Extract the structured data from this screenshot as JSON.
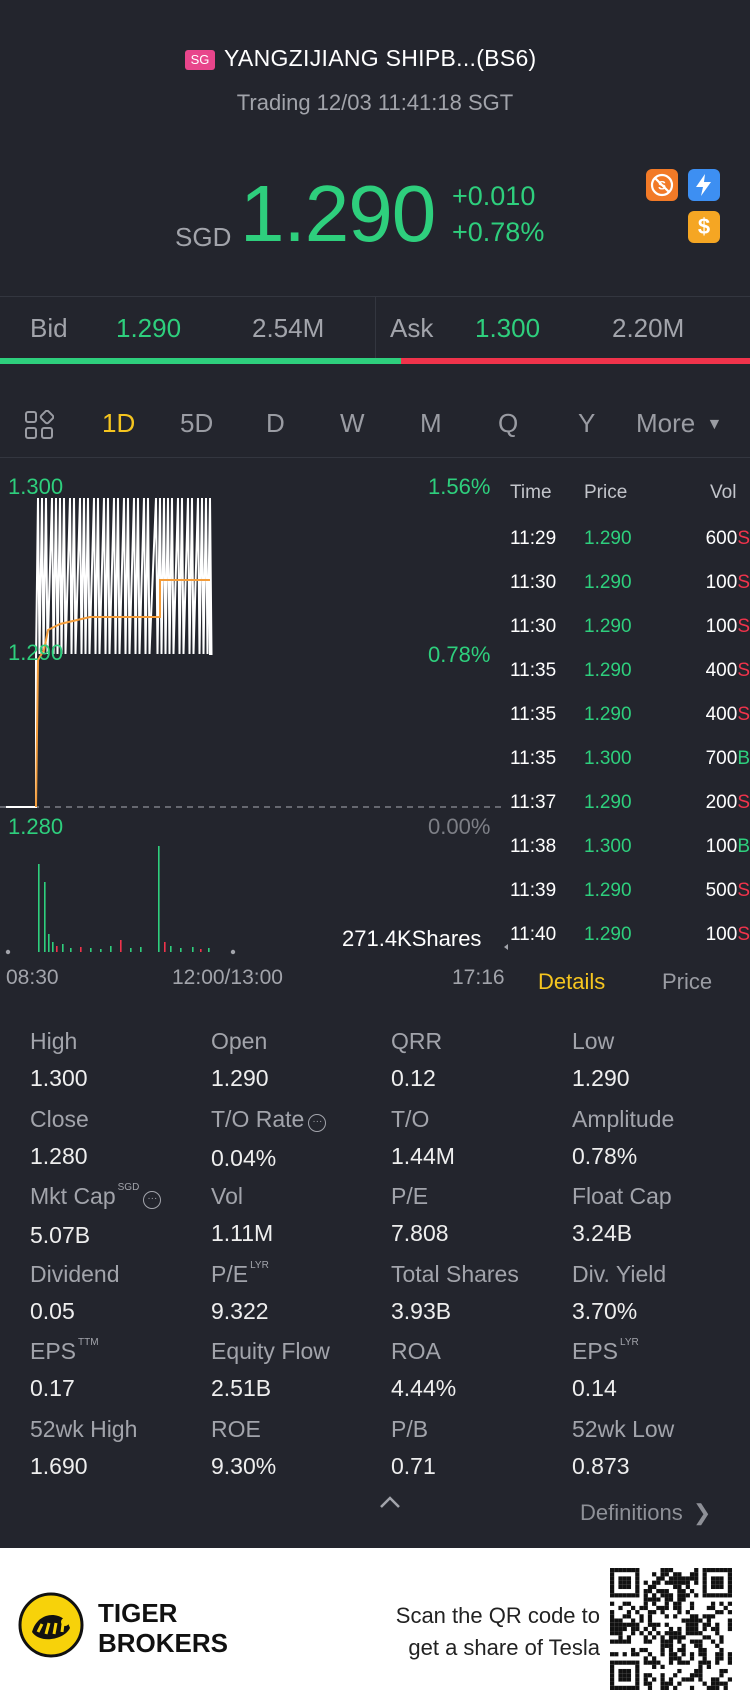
{
  "header": {
    "market_badge": "SG",
    "stock_name": "YANGZIJIANG SHIPB...(BS6)",
    "status": "Trading 12/03 11:41:18 SGT",
    "currency": "SGD",
    "price": "1.290",
    "change": "+0.010",
    "change_pct": "+0.78%",
    "icons": [
      "no-short-icon",
      "flash-icon",
      "dollar-icon"
    ]
  },
  "bidask": {
    "bid_label": "Bid",
    "bid_price": "1.290",
    "bid_size": "2.54M",
    "ask_label": "Ask",
    "ask_price": "1.300",
    "ask_size": "2.20M",
    "bid_ratio": 0.535
  },
  "tabs": {
    "items": [
      "1D",
      "5D",
      "D",
      "W",
      "M",
      "Q",
      "Y",
      "More"
    ],
    "active": "1D"
  },
  "chart_labels": {
    "high_price": "1.300",
    "mid_price": "1.290",
    "low_price": "1.280",
    "high_pct": "1.56%",
    "mid_pct": "0.78%",
    "low_pct": "0.00%",
    "volume": "271.4KShares",
    "time_start": "08:30",
    "time_mid": "12:00/13:00",
    "time_end": "17:16"
  },
  "ticks": {
    "headers": {
      "time": "Time",
      "price": "Price",
      "vol": "Vol"
    },
    "rows": [
      {
        "time": "11:29",
        "price": "1.290",
        "vol": "600",
        "side": "S"
      },
      {
        "time": "11:30",
        "price": "1.290",
        "vol": "100",
        "side": "S"
      },
      {
        "time": "11:30",
        "price": "1.290",
        "vol": "100",
        "side": "S"
      },
      {
        "time": "11:35",
        "price": "1.290",
        "vol": "400",
        "side": "S"
      },
      {
        "time": "11:35",
        "price": "1.290",
        "vol": "400",
        "side": "S"
      },
      {
        "time": "11:35",
        "price": "1.300",
        "vol": "700",
        "side": "B"
      },
      {
        "time": "11:37",
        "price": "1.290",
        "vol": "200",
        "side": "S"
      },
      {
        "time": "11:38",
        "price": "1.300",
        "vol": "100",
        "side": "B"
      },
      {
        "time": "11:39",
        "price": "1.290",
        "vol": "500",
        "side": "S"
      },
      {
        "time": "11:40",
        "price": "1.290",
        "vol": "100",
        "side": "S"
      }
    ]
  },
  "detail_tabs": {
    "details": "Details",
    "price": "Price"
  },
  "stats": [
    [
      {
        "label": "High",
        "value": "1.300"
      },
      {
        "label": "Open",
        "value": "1.290"
      },
      {
        "label": "QRR",
        "value": "0.12"
      },
      {
        "label": "Low",
        "value": "1.290"
      }
    ],
    [
      {
        "label": "Close",
        "value": "1.280"
      },
      {
        "label": "T/O Rate",
        "value": "0.04%",
        "icon": true
      },
      {
        "label": "T/O",
        "value": "1.44M"
      },
      {
        "label": "Amplitude",
        "value": "0.78%"
      }
    ],
    [
      {
        "label": "Mkt Cap",
        "value": "5.07B",
        "sup": "SGD",
        "icon": true
      },
      {
        "label": "Vol",
        "value": "1.11M"
      },
      {
        "label": "P/E",
        "value": "7.808"
      },
      {
        "label": "Float Cap",
        "value": "3.24B"
      }
    ],
    [
      {
        "label": "Dividend",
        "value": "0.05"
      },
      {
        "label": "P/E",
        "value": "9.322",
        "sup": "LYR"
      },
      {
        "label": "Total Shares",
        "value": "3.93B"
      },
      {
        "label": "Div. Yield",
        "value": "3.70%"
      }
    ],
    [
      {
        "label": "EPS",
        "value": "0.17",
        "sup": "TTM"
      },
      {
        "label": "Equity Flow",
        "value": "2.51B"
      },
      {
        "label": "ROA",
        "value": "4.44%"
      },
      {
        "label": "EPS",
        "value": "0.14",
        "sup": "LYR"
      }
    ],
    [
      {
        "label": "52wk High",
        "value": "1.690"
      },
      {
        "label": "ROE",
        "value": "9.30%"
      },
      {
        "label": "P/B",
        "value": "0.71"
      },
      {
        "label": "52wk Low",
        "value": "0.873"
      }
    ]
  ],
  "definitions_link": "Definitions",
  "footer": {
    "brand_line1": "TIGER",
    "brand_line2": "BROKERS",
    "scan_line1": "Scan the QR code to",
    "scan_line2": "get a share of Tesla"
  },
  "colors": {
    "background": "#23252d",
    "up_green": "#2ecf7d",
    "down_red": "#f0334b",
    "accent_yellow": "#f5c51f",
    "muted": "#a2a4ab"
  }
}
